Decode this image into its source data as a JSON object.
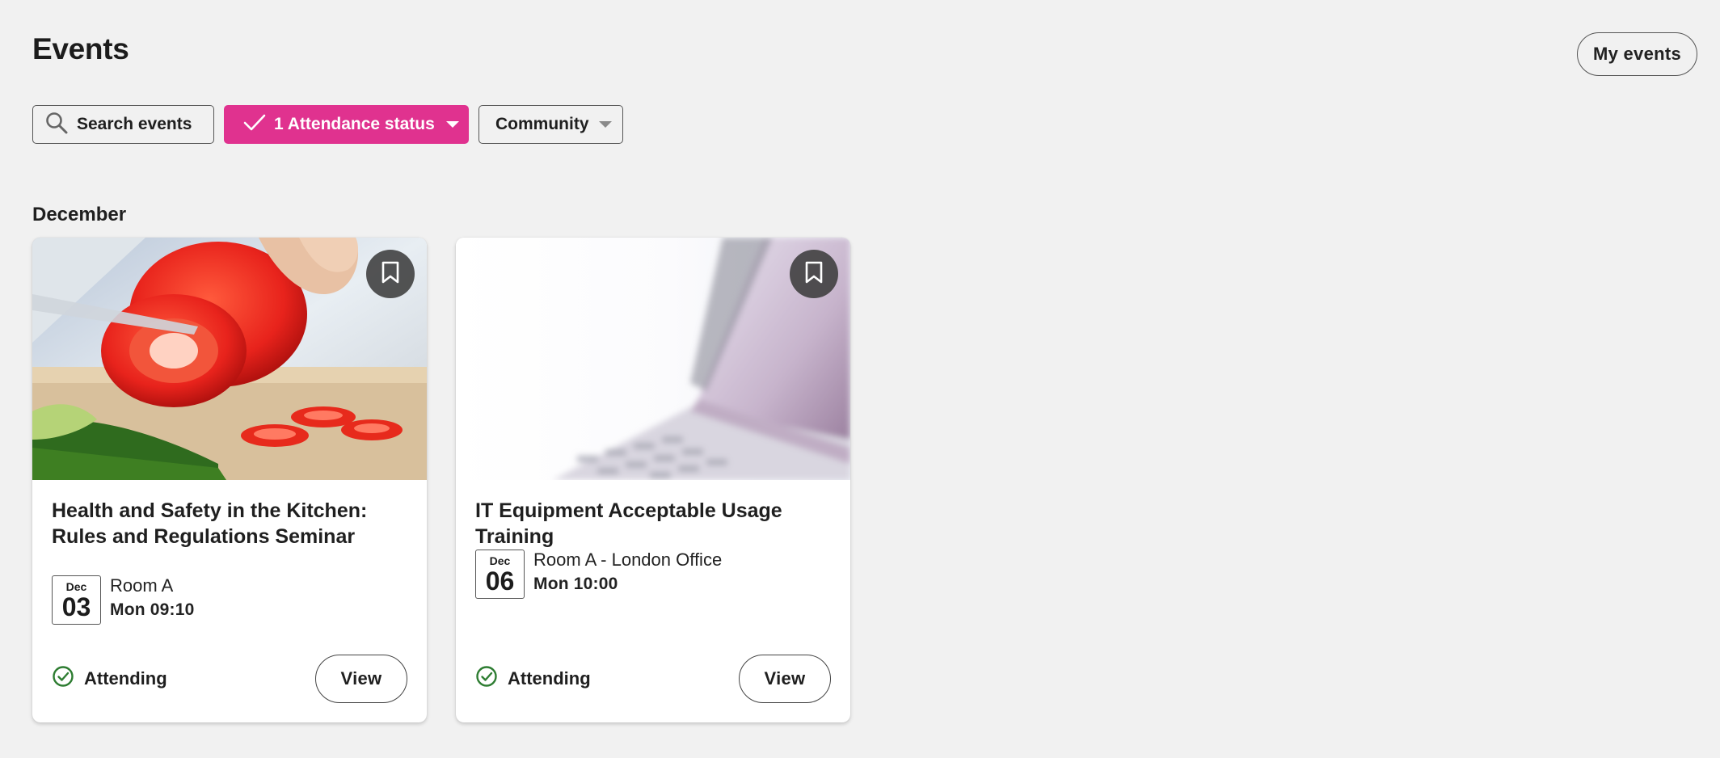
{
  "header": {
    "title": "Events",
    "my_events_label": "My events"
  },
  "filters": {
    "search_label": "Search events",
    "attendance_label": "1 Attendance status",
    "community_label": "Community"
  },
  "colors": {
    "accent": "#e0328f",
    "attending_green": "#2e7d32"
  },
  "sections": [
    {
      "month": "December",
      "events": [
        {
          "title": "Health and Safety in the Kitchen: Rules and Regulations Seminar",
          "date_month": "Dec",
          "date_day": "03",
          "location": "Room A",
          "when": "Mon 09:10",
          "status": "Attending",
          "view_label": "View",
          "image": "kitchen-pepper-image"
        },
        {
          "title": "IT Equipment Acceptable Usage Training",
          "date_month": "Dec",
          "date_day": "06",
          "location": "Room A - London Office",
          "when": "Mon 10:00",
          "status": "Attending",
          "view_label": "View",
          "image": "laptop-keyboard-image"
        }
      ]
    }
  ]
}
